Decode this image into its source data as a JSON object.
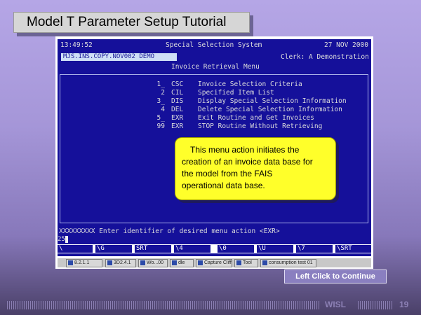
{
  "slide": {
    "title": "Model T Parameter Setup Tutorial",
    "continue_label": "Left Click to Continue",
    "footer_org": "WISL",
    "page_number": "19"
  },
  "terminal": {
    "time": "13:49:52",
    "system_name": "Special Selection System",
    "date": "27 NOV 2000",
    "selection_id": "MJS.INS.COPY.NOV002 DEMO",
    "clerk": "Clerk: A Demonstration",
    "menu_title": "Invoice Retrieval Menu",
    "menu_items": [
      {
        "num": "1_",
        "code": "CSC",
        "desc": "Invoice Selection Criteria"
      },
      {
        "num": "2",
        "code": "CIL",
        "desc": "Specified Item List"
      },
      {
        "num": "3_",
        "code": "DIS",
        "desc": "Display Special Selection Information"
      },
      {
        "num": "4",
        "code": "DEL",
        "desc": "Delete Special Selection Information"
      },
      {
        "num": "5_",
        "code": "EXR",
        "desc": "Exit Routine and Get Invoices"
      },
      {
        "num": "99",
        "code": "EXR",
        "desc": "STOP Routine Without Retrieving"
      }
    ],
    "prompt": "XXXXXXXXX Enter identifier of desired menu action <EXR>",
    "input_value": "25",
    "fkeys": [
      "\\",
      "\\G",
      "SRT",
      "\\4",
      "\\0",
      "\\U",
      "\\7",
      "\\SRT"
    ]
  },
  "callout": {
    "line1": "This menu action initiates the",
    "line2": "creation of an invoice data base for",
    "line3": "the model from the FAIS",
    "line4": "operational data base."
  },
  "taskbar": {
    "items": [
      "8.2.1.1",
      "3D2.4.1",
      "Wo...00",
      "dle",
      "Capture Cliff",
      "Tool",
      "consumption test 01"
    ]
  }
}
